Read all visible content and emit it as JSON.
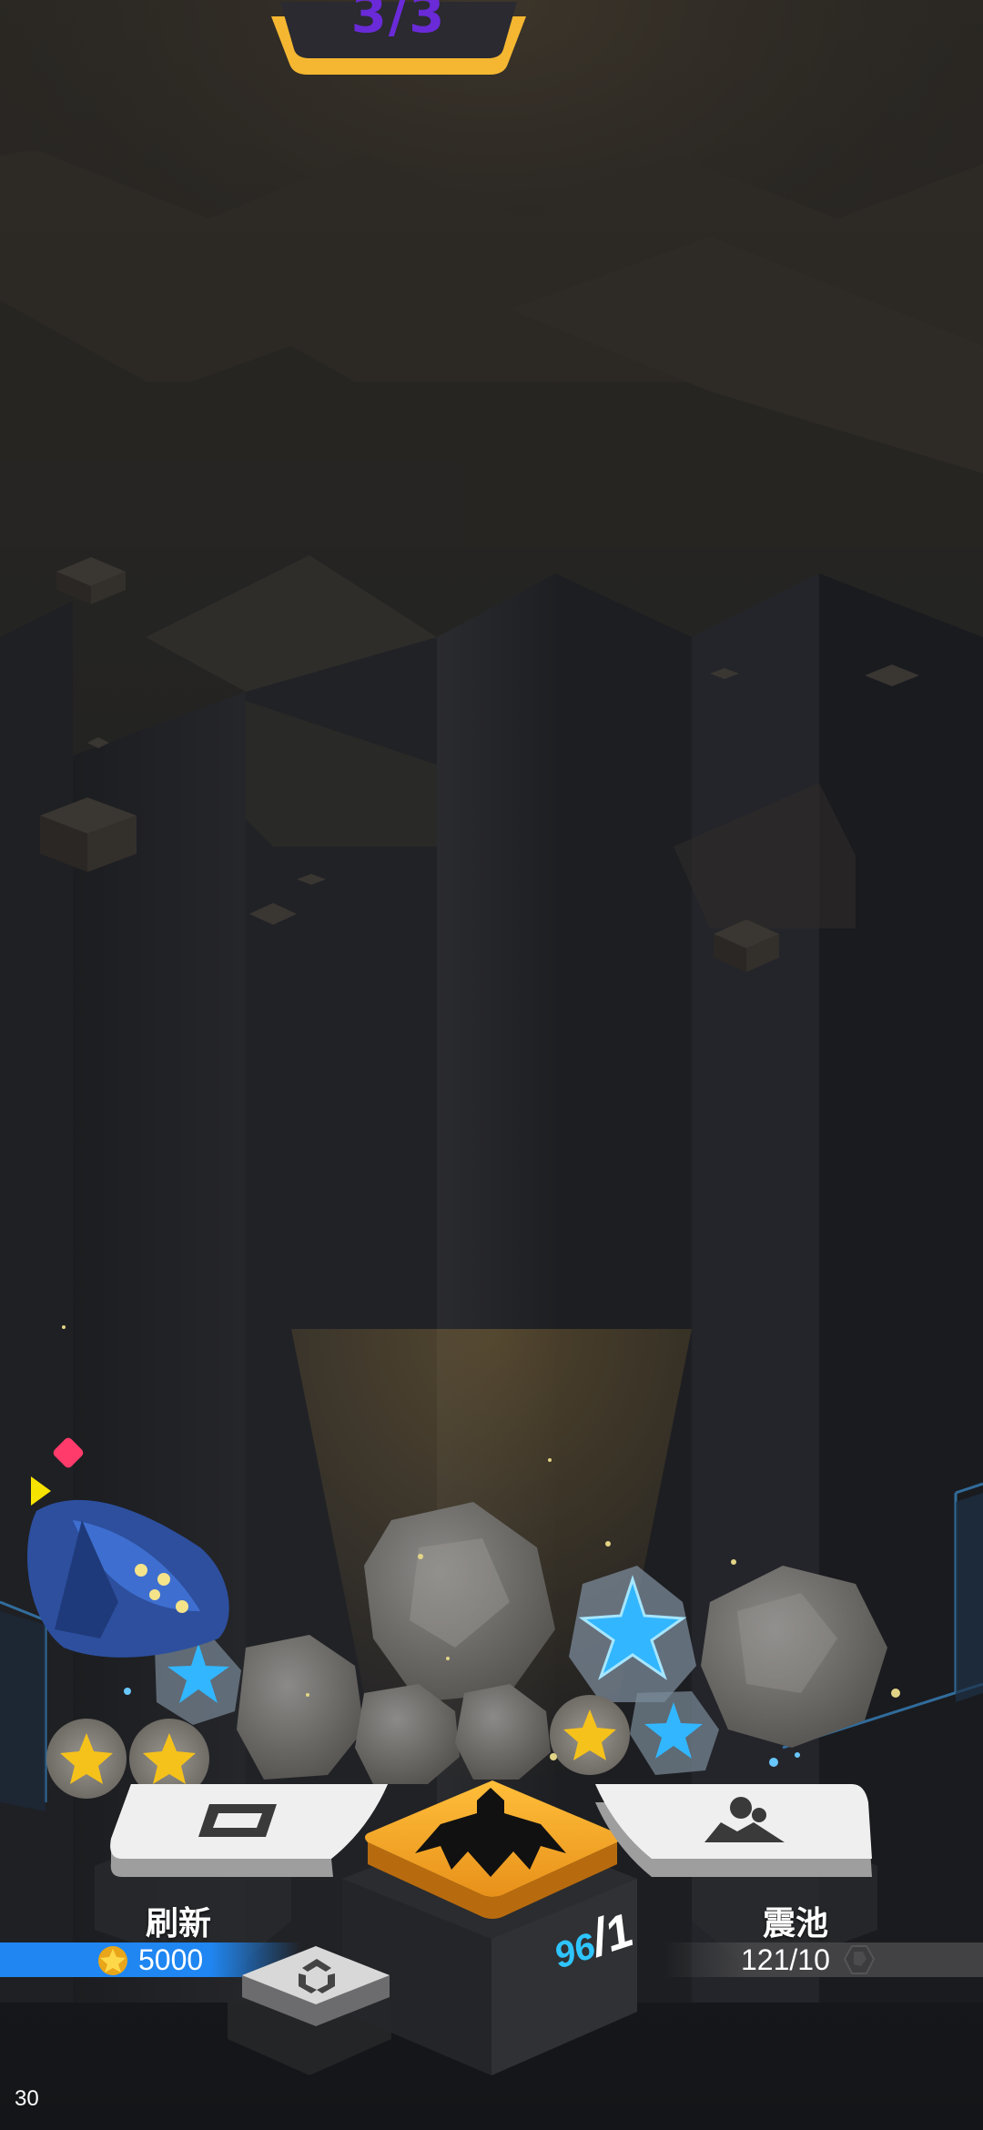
{
  "top_badge": {
    "level_text": "3/3"
  },
  "actions": {
    "refresh": {
      "label": "刷新",
      "cost": "5000",
      "icon": "refresh-frame-icon",
      "cost_icon": "star-coin-icon"
    },
    "main": {
      "icon": "drill-claw-icon",
      "counter_current": "96",
      "counter_separator": "/",
      "counter_max": "1"
    },
    "pool": {
      "label": "震池",
      "value": "121/10",
      "icon": "rock-pile-icon",
      "value_icon": "ore-icon"
    },
    "swap": {
      "icon": "recycle-icon"
    }
  },
  "debug": {
    "fps": "30"
  },
  "colors": {
    "gold": "#f2a21b",
    "blue_bar": "#1f86f2",
    "cyan_text": "#2ec5ff",
    "badge_text": "#6a2ad8",
    "marker_red": "#ff3b6b",
    "marker_yellow": "#f7e300"
  }
}
